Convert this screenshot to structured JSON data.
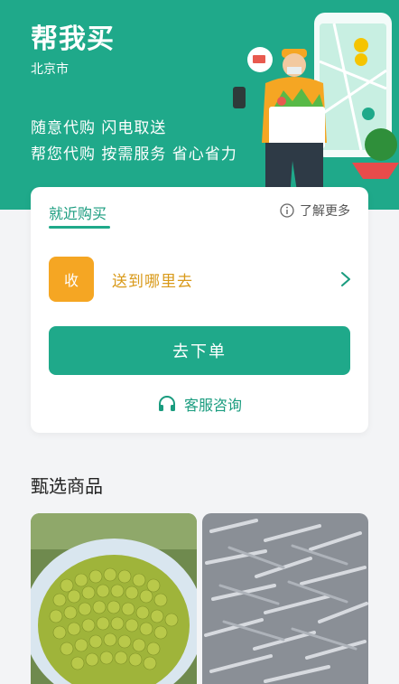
{
  "hero": {
    "title": "帮我买",
    "city": "北京市",
    "slogan_line1": "随意代购 闪电取送",
    "slogan_line2": "帮您代购 按需服务 省心省力",
    "illustration_icon": "delivery-courier-with-phone-map",
    "background_color": "#1fa98a"
  },
  "card": {
    "tab_label": "就近购买",
    "learn_more_label": "了解更多",
    "address": {
      "badge_label": "收",
      "placeholder": "送到哪里去"
    },
    "order_button_label": "去下单",
    "customer_service_label": "客服咨询"
  },
  "products": {
    "section_title": "甄选商品",
    "items": [
      {
        "image_icon": "green-beans-basket-photo"
      },
      {
        "image_icon": "dried-small-fish-photo"
      }
    ]
  },
  "colors": {
    "accent_green": "#1fa98a",
    "badge_orange": "#f5a623",
    "address_text": "#d99a1a"
  }
}
